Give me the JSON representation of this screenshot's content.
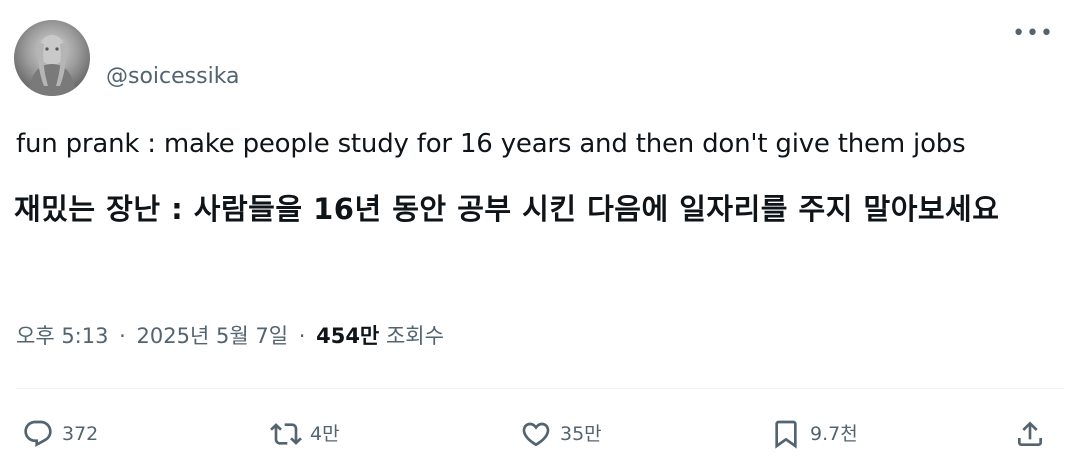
{
  "author": {
    "handle": "@soicessika"
  },
  "tweet": {
    "text_en": "fun prank : make people study for 16 years  and then don't give them jobs",
    "text_ko": "재밌는 장난 : 사람들을 16년 동안 공부 시킨 다음에 일자리를 주지 말아보세요"
  },
  "meta": {
    "time": "오후 5:13",
    "dot1": "·",
    "date": "2025년 5월 7일",
    "dot2": "·",
    "views_count": "454만",
    "views_label": "조회수"
  },
  "actions": {
    "replies": "372",
    "retweets": "4만",
    "likes": "35만",
    "bookmarks": "9.7천"
  },
  "icons": {
    "more": "more-options-icon",
    "reply": "reply-icon",
    "retweet": "retweet-icon",
    "like": "like-icon",
    "bookmark": "bookmark-icon",
    "share": "share-icon"
  },
  "colors": {
    "text_primary": "#0f1419",
    "text_secondary": "#536471",
    "divider": "#eff3f4"
  }
}
